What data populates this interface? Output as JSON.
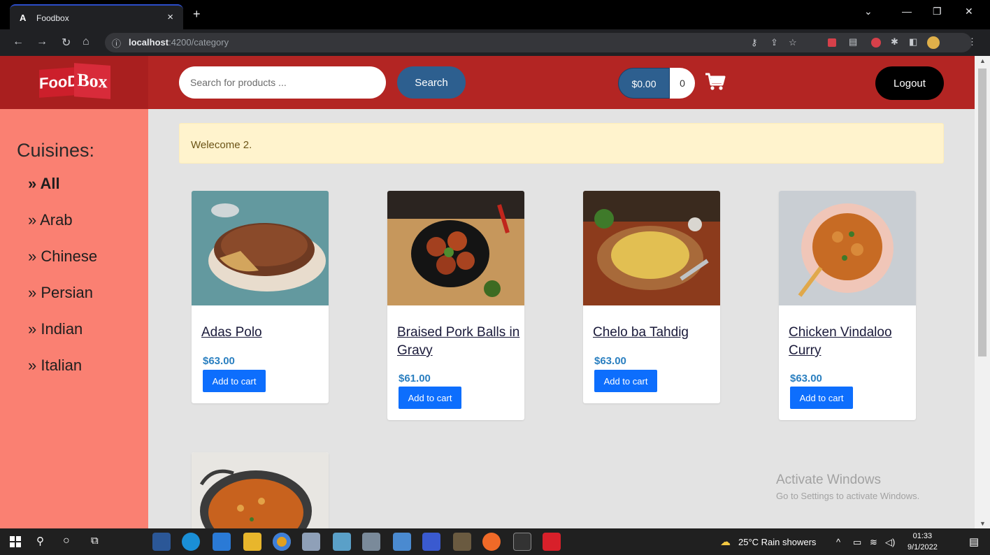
{
  "browser": {
    "tab_favicon": "A",
    "tab_title": "Foodbox",
    "close": "×",
    "new_tab": "+",
    "url_host": "localhost",
    "url_rest": ":4200/category",
    "info_icon": "ⓘ"
  },
  "header": {
    "logo_left": "FooD",
    "logo_right": "Box",
    "search_placeholder": "Search for products ...",
    "search_button": "Search",
    "cart_total": "$0.00",
    "cart_count": "0",
    "logout_button": "Logout"
  },
  "sidebar": {
    "title": "Cuisines:",
    "items": [
      {
        "label": "» All",
        "active": true
      },
      {
        "label": "» Arab"
      },
      {
        "label": "» Chinese"
      },
      {
        "label": "» Persian"
      },
      {
        "label": "» Indian"
      },
      {
        "label": "» Italian"
      }
    ]
  },
  "main": {
    "alert": "Welecome 2.",
    "products": [
      {
        "name": "Adas Polo",
        "price": "$63.00",
        "button": "Add to cart"
      },
      {
        "name": "Braised Pork Balls in Gravy",
        "price": "$61.00",
        "button": "Add to cart"
      },
      {
        "name": "Chelo ba Tahdig",
        "price": "$63.00",
        "button": "Add to cart"
      },
      {
        "name": "Chicken Vindaloo Curry",
        "price": "$63.00",
        "button": "Add to cart"
      }
    ]
  },
  "watermark": {
    "line1": "Activate Windows",
    "line2": "Go to Settings to activate Windows."
  },
  "taskbar": {
    "weather": "25°C  Rain showers",
    "time": "01:33",
    "date": "9/1/2022"
  },
  "colors": {
    "header": "#b32523",
    "sidebar": "#fa8072",
    "accent": "#0d6efd",
    "price": "#2a7fc0"
  }
}
